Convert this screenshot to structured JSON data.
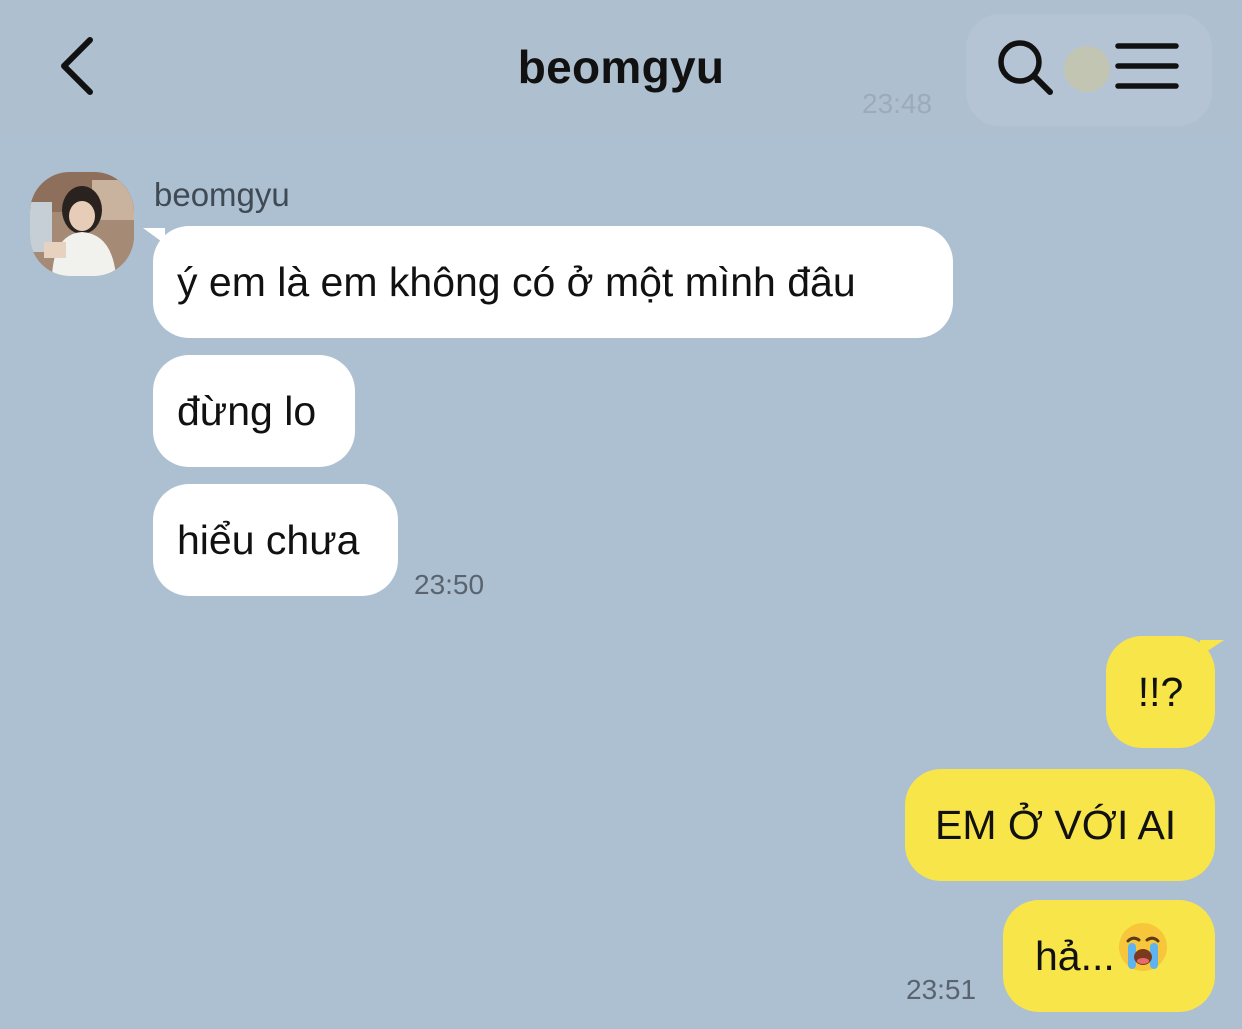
{
  "header": {
    "back_icon": "chevron-left-icon",
    "title": "beomgyu",
    "search_icon": "search-icon",
    "menu_icon": "hamburger-menu-icon",
    "ghost_time": "23:48"
  },
  "messages": {
    "incoming": {
      "sender": "beomgyu",
      "items": [
        "ý em là em không có ở một mình đâu",
        "đừng lo",
        "hiểu chưa"
      ],
      "time": "23:50"
    },
    "outgoing": {
      "items": [
        "!!?",
        "EM Ở VỚI AI",
        "hả..."
      ],
      "last_emoji": "loudly-crying-face-emoji",
      "time": "23:51"
    }
  },
  "colors": {
    "background": "#adc0d1",
    "incoming_bubble": "#ffffff",
    "outgoing_bubble": "#f8e54a"
  }
}
